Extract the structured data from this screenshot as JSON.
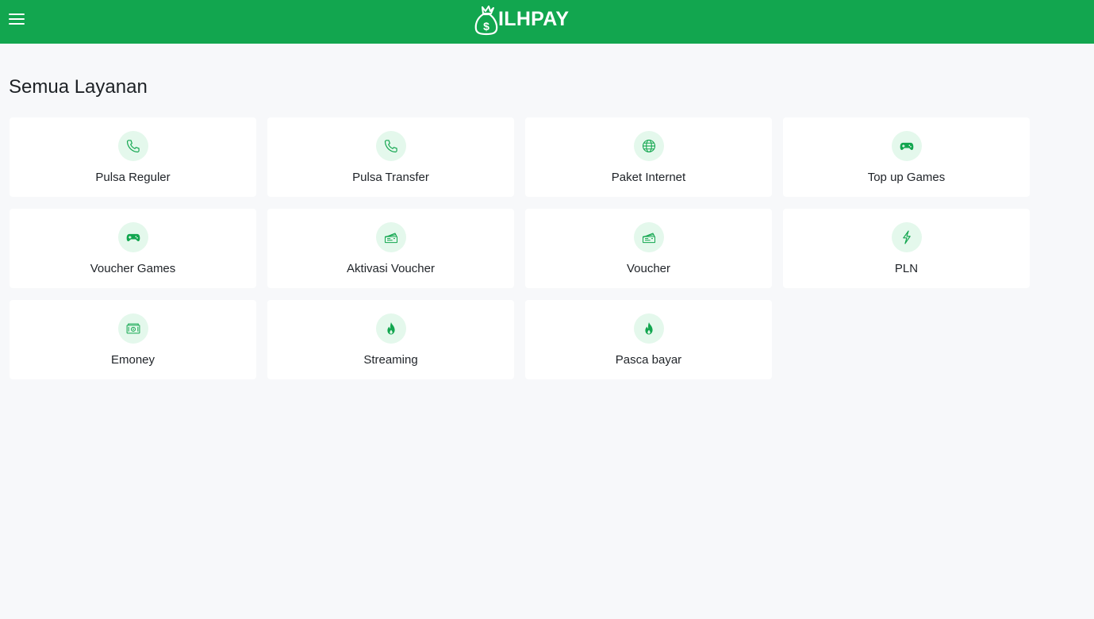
{
  "header": {
    "brand": "ILHPAY",
    "bg_color": "#12a64f",
    "logo_icon": "money-bag-icon",
    "menu_icon": "hamburger-menu-icon"
  },
  "page": {
    "title": "Semua Layanan"
  },
  "accent_color": "#12a64f",
  "icon_bg_color": "#e4f8ec",
  "services": [
    {
      "label": "Pulsa Reguler",
      "icon": "phone-icon"
    },
    {
      "label": "Pulsa Transfer",
      "icon": "phone-icon"
    },
    {
      "label": "Paket Internet",
      "icon": "globe-icon"
    },
    {
      "label": "Top up Games",
      "icon": "gamepad-icon"
    },
    {
      "label": "Voucher Games",
      "icon": "gamepad-icon"
    },
    {
      "label": "Aktivasi Voucher",
      "icon": "ticket-icon"
    },
    {
      "label": "Voucher",
      "icon": "ticket-icon"
    },
    {
      "label": "PLN",
      "icon": "lightning-icon"
    },
    {
      "label": "Emoney",
      "icon": "cash-icon"
    },
    {
      "label": "Streaming",
      "icon": "flame-icon"
    },
    {
      "label": "Pasca bayar",
      "icon": "flame-icon"
    }
  ]
}
